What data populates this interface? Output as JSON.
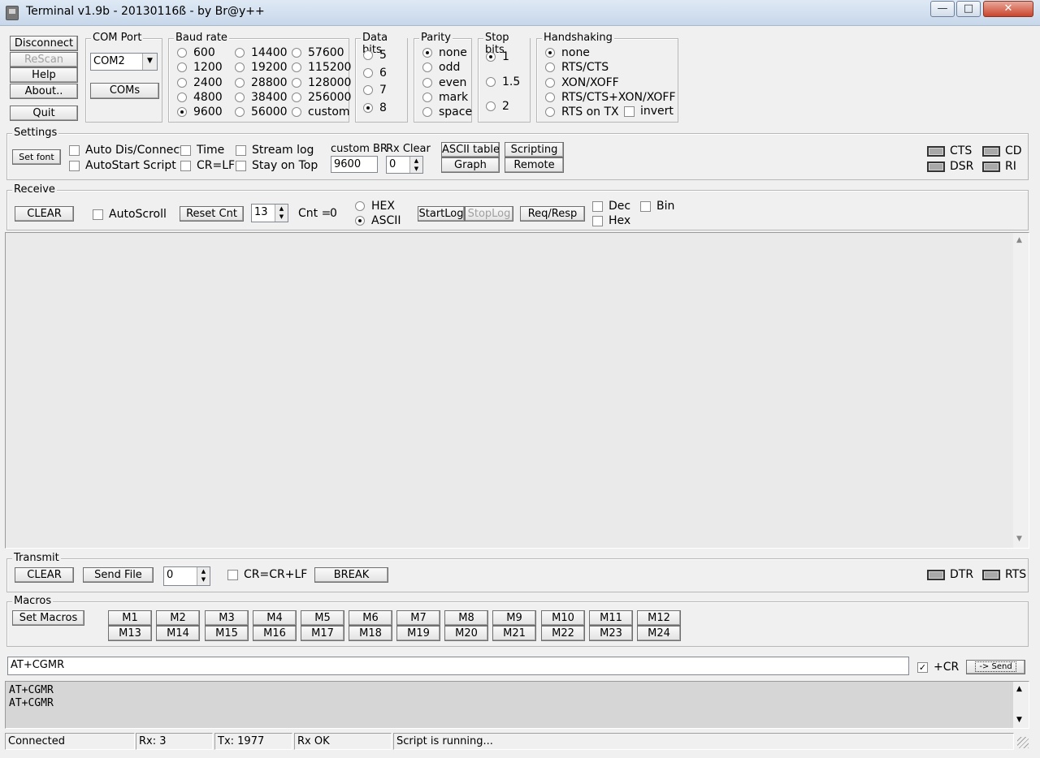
{
  "window": {
    "title": "Terminal v1.9b - 20130116ß - by Br@y++",
    "min": "—",
    "max": "□",
    "close": "✕"
  },
  "top_buttons": {
    "disconnect": "Disconnect",
    "rescan": "ReScan",
    "help": "Help",
    "about": "About..",
    "quit": "Quit"
  },
  "com_port": {
    "label": "COM Port",
    "value": "COM2",
    "coms": "COMs"
  },
  "baud": {
    "label": "Baud rate",
    "options": [
      "600",
      "1200",
      "2400",
      "4800",
      "9600",
      "14400",
      "19200",
      "28800",
      "38400",
      "56000",
      "57600",
      "115200",
      "128000",
      "256000",
      "custom"
    ],
    "selected": "9600"
  },
  "data_bits": {
    "label": "Data bits",
    "options": [
      "5",
      "6",
      "7",
      "8"
    ],
    "selected": "8"
  },
  "parity": {
    "label": "Parity",
    "options": [
      "none",
      "odd",
      "even",
      "mark",
      "space"
    ],
    "selected": "none"
  },
  "stop_bits": {
    "label": "Stop bits",
    "options": [
      "1",
      "1.5",
      "2"
    ],
    "selected": "1"
  },
  "handshaking": {
    "label": "Handshaking",
    "options": [
      "none",
      "RTS/CTS",
      "XON/XOFF",
      "RTS/CTS+XON/XOFF",
      "RTS on TX"
    ],
    "selected": "none",
    "invert": "invert"
  },
  "settings": {
    "label": "Settings",
    "set_font": "Set font",
    "auto_dis": "Auto Dis/Connect",
    "autostart": "AutoStart Script",
    "time": "Time",
    "crlf": "CR=LF",
    "stream_log": "Stream log",
    "stay_on_top": "Stay on Top",
    "custom_br_label": "custom BR",
    "custom_br_value": "9600",
    "rx_clear_label": "Rx Clear",
    "rx_clear_value": "0",
    "ascii_table": "ASCII table",
    "scripting": "Scripting",
    "graph": "Graph",
    "remote": "Remote"
  },
  "leds_top": {
    "cts": "CTS",
    "cd": "CD",
    "dsr": "DSR",
    "ri": "RI"
  },
  "receive": {
    "label": "Receive",
    "clear": "CLEAR",
    "autoscroll": "AutoScroll",
    "reset_cnt": "Reset Cnt",
    "cnt_spin": "13",
    "cnt_label": "Cnt =",
    "cnt_value": "0",
    "hex": "HEX",
    "ascii": "ASCII",
    "mode_selected": "ASCII",
    "startlog": "StartLog",
    "stoplog": "StopLog",
    "req_resp": "Req/Resp",
    "dec": "Dec",
    "bin": "Bin",
    "hex_cb": "Hex"
  },
  "transmit": {
    "label": "Transmit",
    "clear": "CLEAR",
    "send_file": "Send File",
    "spin": "0",
    "cr": "CR=CR+LF",
    "break": "BREAK",
    "dtr": "DTR",
    "rts": "RTS"
  },
  "macros": {
    "label": "Macros",
    "set_macros": "Set Macros",
    "row1": [
      "M1",
      "M2",
      "M3",
      "M4",
      "M5",
      "M6",
      "M7",
      "M8",
      "M9",
      "M10",
      "M11",
      "M12"
    ],
    "row2": [
      "M13",
      "M14",
      "M15",
      "M16",
      "M17",
      "M18",
      "M19",
      "M20",
      "M21",
      "M22",
      "M23",
      "M24"
    ]
  },
  "command": {
    "value": "AT+CGMR",
    "plus_cr": "+CR",
    "send": "-> Send"
  },
  "tx_log": [
    "AT+CGMR",
    "AT+CGMR"
  ],
  "status": {
    "connection": "Connected",
    "rx": "Rx: 3",
    "tx": "Tx: 1977",
    "rx_ok": "Rx OK",
    "script": "Script is running..."
  },
  "scroll": {
    "up": "▲",
    "down": "▼"
  }
}
